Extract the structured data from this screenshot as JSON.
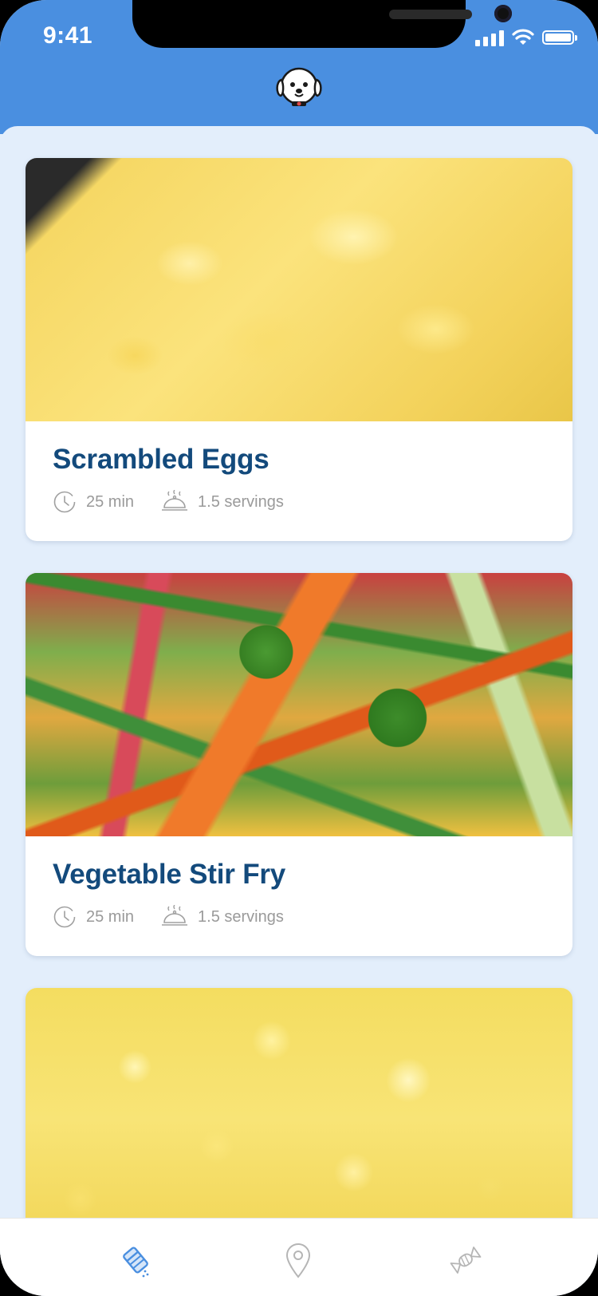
{
  "status_bar": {
    "time": "9:41"
  },
  "header": {
    "logo_icon": "dog-face-icon"
  },
  "recipes": [
    {
      "title": "Scrambled Eggs",
      "time": "25 min",
      "servings": "1.5 servings",
      "image": "scrambled-eggs-photo"
    },
    {
      "title": "Vegetable Stir Fry",
      "time": "25 min",
      "servings": "1.5 servings",
      "image": "vegetable-stir-fry-photo"
    },
    {
      "title": "",
      "time": "",
      "servings": "",
      "image": "scrambled-eggs-closeup-photo"
    }
  ],
  "tab_bar": {
    "items": [
      {
        "icon": "salt-shaker-icon",
        "active": true
      },
      {
        "icon": "map-pin-icon",
        "active": false
      },
      {
        "icon": "candy-icon",
        "active": false
      }
    ],
    "active_color": "#4a8fe0",
    "inactive_color": "#b5b5b5"
  },
  "colors": {
    "header": "#4a8fe0",
    "background": "#e3eefb",
    "title": "#134a7c",
    "meta": "#9a9a9a"
  }
}
